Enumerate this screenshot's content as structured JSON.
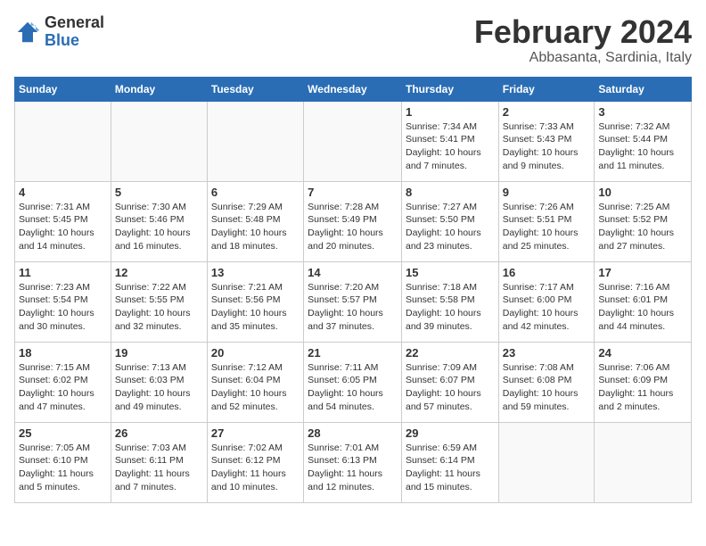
{
  "logo": {
    "general": "General",
    "blue": "Blue"
  },
  "header": {
    "month": "February 2024",
    "location": "Abbasanta, Sardinia, Italy"
  },
  "weekdays": [
    "Sunday",
    "Monday",
    "Tuesday",
    "Wednesday",
    "Thursday",
    "Friday",
    "Saturday"
  ],
  "weeks": [
    [
      {
        "day": "",
        "info": ""
      },
      {
        "day": "",
        "info": ""
      },
      {
        "day": "",
        "info": ""
      },
      {
        "day": "",
        "info": ""
      },
      {
        "day": "1",
        "info": "Sunrise: 7:34 AM\nSunset: 5:41 PM\nDaylight: 10 hours\nand 7 minutes."
      },
      {
        "day": "2",
        "info": "Sunrise: 7:33 AM\nSunset: 5:43 PM\nDaylight: 10 hours\nand 9 minutes."
      },
      {
        "day": "3",
        "info": "Sunrise: 7:32 AM\nSunset: 5:44 PM\nDaylight: 10 hours\nand 11 minutes."
      }
    ],
    [
      {
        "day": "4",
        "info": "Sunrise: 7:31 AM\nSunset: 5:45 PM\nDaylight: 10 hours\nand 14 minutes."
      },
      {
        "day": "5",
        "info": "Sunrise: 7:30 AM\nSunset: 5:46 PM\nDaylight: 10 hours\nand 16 minutes."
      },
      {
        "day": "6",
        "info": "Sunrise: 7:29 AM\nSunset: 5:48 PM\nDaylight: 10 hours\nand 18 minutes."
      },
      {
        "day": "7",
        "info": "Sunrise: 7:28 AM\nSunset: 5:49 PM\nDaylight: 10 hours\nand 20 minutes."
      },
      {
        "day": "8",
        "info": "Sunrise: 7:27 AM\nSunset: 5:50 PM\nDaylight: 10 hours\nand 23 minutes."
      },
      {
        "day": "9",
        "info": "Sunrise: 7:26 AM\nSunset: 5:51 PM\nDaylight: 10 hours\nand 25 minutes."
      },
      {
        "day": "10",
        "info": "Sunrise: 7:25 AM\nSunset: 5:52 PM\nDaylight: 10 hours\nand 27 minutes."
      }
    ],
    [
      {
        "day": "11",
        "info": "Sunrise: 7:23 AM\nSunset: 5:54 PM\nDaylight: 10 hours\nand 30 minutes."
      },
      {
        "day": "12",
        "info": "Sunrise: 7:22 AM\nSunset: 5:55 PM\nDaylight: 10 hours\nand 32 minutes."
      },
      {
        "day": "13",
        "info": "Sunrise: 7:21 AM\nSunset: 5:56 PM\nDaylight: 10 hours\nand 35 minutes."
      },
      {
        "day": "14",
        "info": "Sunrise: 7:20 AM\nSunset: 5:57 PM\nDaylight: 10 hours\nand 37 minutes."
      },
      {
        "day": "15",
        "info": "Sunrise: 7:18 AM\nSunset: 5:58 PM\nDaylight: 10 hours\nand 39 minutes."
      },
      {
        "day": "16",
        "info": "Sunrise: 7:17 AM\nSunset: 6:00 PM\nDaylight: 10 hours\nand 42 minutes."
      },
      {
        "day": "17",
        "info": "Sunrise: 7:16 AM\nSunset: 6:01 PM\nDaylight: 10 hours\nand 44 minutes."
      }
    ],
    [
      {
        "day": "18",
        "info": "Sunrise: 7:15 AM\nSunset: 6:02 PM\nDaylight: 10 hours\nand 47 minutes."
      },
      {
        "day": "19",
        "info": "Sunrise: 7:13 AM\nSunset: 6:03 PM\nDaylight: 10 hours\nand 49 minutes."
      },
      {
        "day": "20",
        "info": "Sunrise: 7:12 AM\nSunset: 6:04 PM\nDaylight: 10 hours\nand 52 minutes."
      },
      {
        "day": "21",
        "info": "Sunrise: 7:11 AM\nSunset: 6:05 PM\nDaylight: 10 hours\nand 54 minutes."
      },
      {
        "day": "22",
        "info": "Sunrise: 7:09 AM\nSunset: 6:07 PM\nDaylight: 10 hours\nand 57 minutes."
      },
      {
        "day": "23",
        "info": "Sunrise: 7:08 AM\nSunset: 6:08 PM\nDaylight: 10 hours\nand 59 minutes."
      },
      {
        "day": "24",
        "info": "Sunrise: 7:06 AM\nSunset: 6:09 PM\nDaylight: 11 hours\nand 2 minutes."
      }
    ],
    [
      {
        "day": "25",
        "info": "Sunrise: 7:05 AM\nSunset: 6:10 PM\nDaylight: 11 hours\nand 5 minutes."
      },
      {
        "day": "26",
        "info": "Sunrise: 7:03 AM\nSunset: 6:11 PM\nDaylight: 11 hours\nand 7 minutes."
      },
      {
        "day": "27",
        "info": "Sunrise: 7:02 AM\nSunset: 6:12 PM\nDaylight: 11 hours\nand 10 minutes."
      },
      {
        "day": "28",
        "info": "Sunrise: 7:01 AM\nSunset: 6:13 PM\nDaylight: 11 hours\nand 12 minutes."
      },
      {
        "day": "29",
        "info": "Sunrise: 6:59 AM\nSunset: 6:14 PM\nDaylight: 11 hours\nand 15 minutes."
      },
      {
        "day": "",
        "info": ""
      },
      {
        "day": "",
        "info": ""
      }
    ]
  ]
}
